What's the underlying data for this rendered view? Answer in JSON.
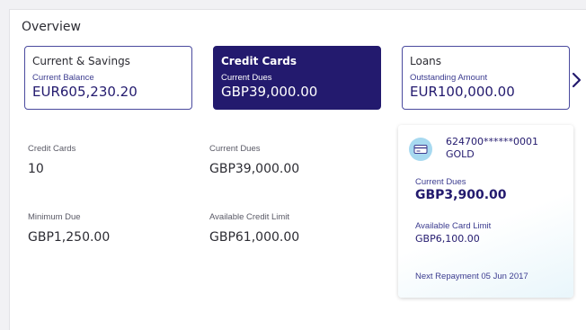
{
  "overview": {
    "title": "Overview"
  },
  "tabs": [
    {
      "label": "Current & Savings",
      "sub_label": "Current Balance",
      "value": "EUR605,230.20",
      "active": false
    },
    {
      "label": "Credit Cards",
      "sub_label": "Current Dues",
      "value": "GBP39,000.00",
      "active": true
    },
    {
      "label": "Loans",
      "sub_label": "Outstanding Amount",
      "value": "EUR100,000.00",
      "active": false
    }
  ],
  "stats": {
    "credit_cards_label": "Credit Cards",
    "credit_cards_value": "10",
    "current_dues_label": "Current Dues",
    "current_dues_value": "GBP39,000.00",
    "minimum_due_label": "Minimum Due",
    "minimum_due_value": "GBP1,250.00",
    "available_limit_label": "Available Credit Limit",
    "available_limit_value": "GBP61,000.00"
  },
  "card": {
    "number": "624700******0001",
    "type": "GOLD",
    "current_dues_label": "Current Dues",
    "current_dues_value": "GBP3,900.00",
    "available_limit_label": "Available Card Limit",
    "available_limit_value": "GBP6,100.00",
    "next_repayment": "Next Repayment  05 Jun 2017",
    "icon": "credit-card-icon"
  },
  "nav": {
    "next_icon": "chevron-right-icon"
  },
  "colors": {
    "accent": "#231a6e",
    "card_icon_bg": "#a7d9f0"
  }
}
